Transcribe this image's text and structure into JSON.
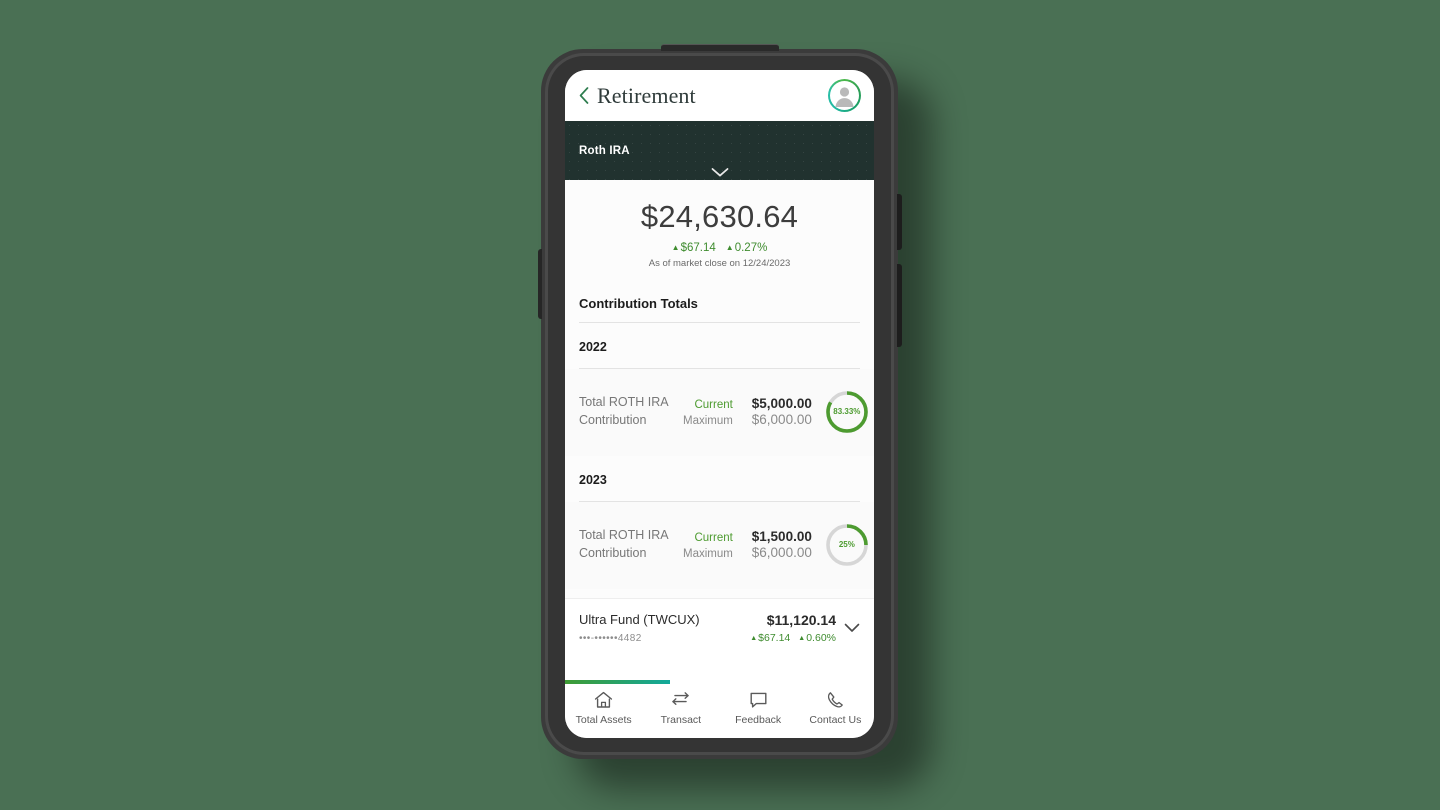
{
  "appbar": {
    "back_icon": "chevron-left-icon",
    "title": "Retirement",
    "avatar_icon": "user-avatar-icon"
  },
  "account_band": {
    "account_name": "Roth IRA",
    "expand_icon": "chevron-down-icon"
  },
  "balance": {
    "amount": "$24,630.64",
    "change_amount": "$67.14",
    "change_percent": "0.27%",
    "change_direction_icon": "triangle-up-icon",
    "as_of": "As of market close on 12/24/2023"
  },
  "contribution_totals": {
    "section_title": "Contribution Totals",
    "years": [
      {
        "year": "2022",
        "label": "Total ROTH IRA Contribution",
        "current_tag": "Current",
        "current_value": "$5,000.00",
        "maximum_tag": "Maximum",
        "maximum_value": "$6,000.00",
        "percent_label": "83.33%",
        "percent_value": 83.33
      },
      {
        "year": "2023",
        "label": "Total ROTH IRA Contribution",
        "current_tag": "Current",
        "current_value": "$1,500.00",
        "maximum_tag": "Maximum",
        "maximum_value": "$6,000.00",
        "percent_label": "25%",
        "percent_value": 25
      }
    ]
  },
  "holdings": [
    {
      "name": "Ultra Fund (TWCUX)",
      "account_masked": "•••-••••••4482",
      "value": "$11,120.14",
      "change_amount": "$67.14",
      "change_percent": "0.60%",
      "expand_icon": "chevron-down-icon"
    }
  ],
  "scroll_progress_percent": 34,
  "bottom_nav": [
    {
      "label": "Total Assets",
      "icon": "home-icon"
    },
    {
      "label": "Transact",
      "icon": "transfer-arrows-icon"
    },
    {
      "label": "Feedback",
      "icon": "chat-bubble-icon"
    },
    {
      "label": "Contact Us",
      "icon": "phone-icon"
    }
  ],
  "colors": {
    "background": "#4a7054",
    "account_band": "#21322f",
    "positive_green": "#3f8c2f",
    "donut_green": "#4d9b30",
    "donut_track": "#d6d6d6",
    "accent_teal": "#13a99b"
  }
}
